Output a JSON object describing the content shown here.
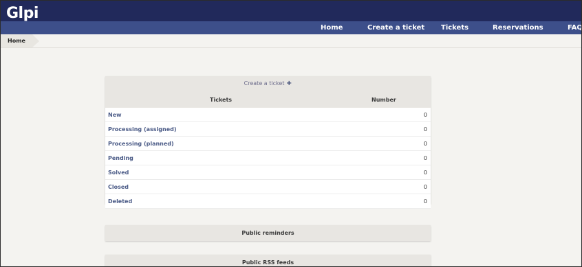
{
  "app": {
    "logo_text": "Glpi"
  },
  "nav": {
    "items": [
      {
        "label": "Home"
      },
      {
        "label": "Create a ticket"
      },
      {
        "label": "Tickets"
      },
      {
        "label": "Reservations"
      },
      {
        "label": "FAQ"
      }
    ]
  },
  "breadcrumb": {
    "home": "Home"
  },
  "tickets_panel": {
    "create_ticket_label": "Create a ticket",
    "plus_symbol": "+",
    "headers": {
      "tickets": "Tickets",
      "number": "Number"
    },
    "rows": [
      {
        "label": "New",
        "count": "0"
      },
      {
        "label": "Processing (assigned)",
        "count": "0"
      },
      {
        "label": "Processing (planned)",
        "count": "0"
      },
      {
        "label": "Pending",
        "count": "0"
      },
      {
        "label": "Solved",
        "count": "0"
      },
      {
        "label": "Closed",
        "count": "0"
      },
      {
        "label": "Deleted",
        "count": "0"
      }
    ]
  },
  "public_reminders": {
    "title": "Public reminders"
  },
  "public_rss": {
    "title": "Public RSS feeds"
  },
  "colors": {
    "topbar": "#21295b",
    "navbar": "#3d4f8a",
    "background": "#f4f3f0"
  }
}
